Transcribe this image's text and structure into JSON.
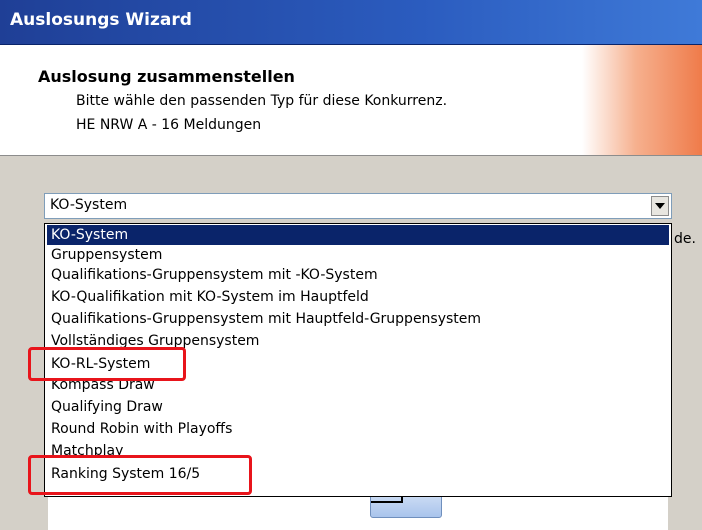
{
  "window": {
    "title": "Auslosungs Wizard"
  },
  "header": {
    "title": "Auslosung zusammenstellen",
    "line1": "Bitte wähle den passenden Typ für diese Konkurrenz.",
    "line2": "HE NRW A - 16 Meldungen",
    "accent_color": "#ef7b4a"
  },
  "combo": {
    "selected_value": "KO-System",
    "button_icon": "chevron-down-icon"
  },
  "dropdown": {
    "options": [
      "KO-System",
      "Gruppensystem",
      "Qualifikations-Gruppensystem mit -KO-System",
      "KO-Qualifikation mit KO-System im Hauptfeld",
      "Qualifikations-Gruppensystem mit Hauptfeld-Gruppensystem",
      "Vollständiges Gruppensystem",
      "KO-RL-System",
      "Kompass Draw",
      "Qualifying Draw",
      "Round Robin with Playoffs",
      "Matchplay",
      "Ranking System 16/5"
    ],
    "highlighted_index": 0,
    "selection_color": "#0a246a"
  },
  "side_fragment": "de.",
  "annotations": {
    "highlight_color": "#e8141b",
    "highlighted_options": [
      "KO-RL-System",
      "Ranking System 16/5"
    ]
  }
}
